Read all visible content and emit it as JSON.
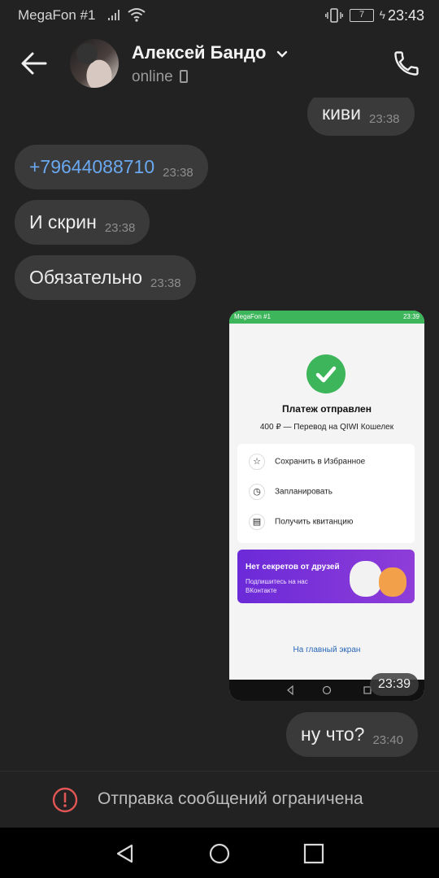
{
  "status_bar": {
    "carrier": "MegaFon #1",
    "battery": "7",
    "time": "23:43"
  },
  "header": {
    "contact_name": "Алексей Бандо",
    "presence": "online"
  },
  "messages": [
    {
      "text": "киви",
      "time": "23:38",
      "direction": "outgoing"
    },
    {
      "text": "+79644088710",
      "time": "23:38",
      "direction": "incoming"
    },
    {
      "text": "И скрин",
      "time": "23:38",
      "direction": "incoming"
    },
    {
      "text": "Обязательно",
      "time": "23:38",
      "direction": "incoming"
    },
    {
      "text": "ну что?",
      "time": "23:40",
      "direction": "outgoing"
    }
  ],
  "screenshot": {
    "time": "23:39",
    "status_carrier": "MegaFon #1",
    "status_time": "23:39",
    "title": "Платеж отправлен",
    "subtitle": "400 ₽ — Перевод на QIWI Кошелек",
    "options": [
      "Сохранить в Избранное",
      "Запланировать",
      "Получить квитанцию"
    ],
    "promo_title": "Нет секретов от друзей",
    "promo_subtitle": "Подпишитесь на нас ВКонтакте",
    "home_link": "На главный экран",
    "accent_color": "#3cb55b"
  },
  "restriction": {
    "text": "Отправка сообщений ограничена",
    "color": "#e05555"
  }
}
